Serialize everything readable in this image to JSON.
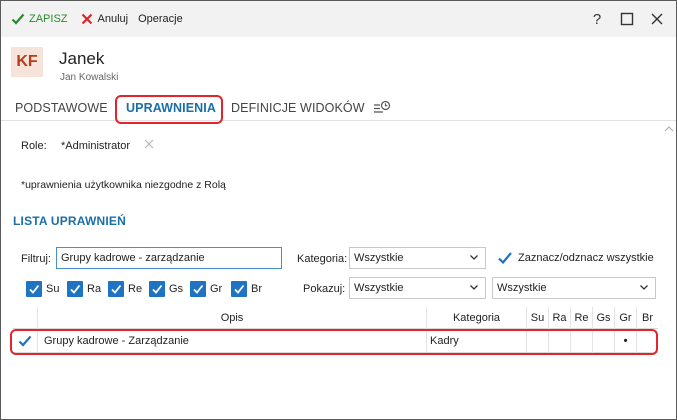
{
  "toolbar": {
    "save_label": "ZAPISZ",
    "cancel_label": "Anuluj",
    "operations_label": "Operacje",
    "help_label": "?"
  },
  "header": {
    "initials": "KF",
    "name": "Janek",
    "full_name": "Jan Kowalski"
  },
  "tabs": [
    {
      "label": "PODSTAWOWE"
    },
    {
      "label": "UPRAWNIENIA"
    },
    {
      "label": "DEFINICJE WIDOKÓW"
    }
  ],
  "roles": {
    "label": "Role:",
    "value": "*Administrator"
  },
  "note": "*uprawnienia użytkownika niezgodne z Rolą",
  "section_title": "LISTA UPRAWNIEŃ",
  "filters": {
    "filter_label": "Filtruj:",
    "filter_value": "Grupy kadrowe - zarządzanie",
    "category_label": "Kategoria:",
    "category_value": "Wszystkie",
    "check_all_label": "Zaznacz/odznacz wszystkie",
    "show_label": "Pokazuj:",
    "show_value": "Wszystkie",
    "show_value2": "Wszystkie",
    "checkboxes": [
      {
        "label": "Su",
        "checked": true
      },
      {
        "label": "Ra",
        "checked": true
      },
      {
        "label": "Re",
        "checked": true
      },
      {
        "label": "Gs",
        "checked": true
      },
      {
        "label": "Gr",
        "checked": true
      },
      {
        "label": "Br",
        "checked": true
      }
    ]
  },
  "table": {
    "columns": [
      "Opis",
      "Kategoria",
      "Su",
      "Ra",
      "Re",
      "Gs",
      "Gr",
      "Br"
    ],
    "rows": [
      {
        "checked": true,
        "opis": "Grupy kadrowe - Zarządzanie",
        "kategoria": "Kadry",
        "gr_mark": "•"
      }
    ]
  },
  "colors": {
    "accent": "#1b6fa8",
    "save": "#2a8a2a",
    "cancel": "#d9262c",
    "highlight": "#e0262c",
    "avatar_bg": "#f6e3da",
    "avatar_fg": "#b83b1a"
  }
}
